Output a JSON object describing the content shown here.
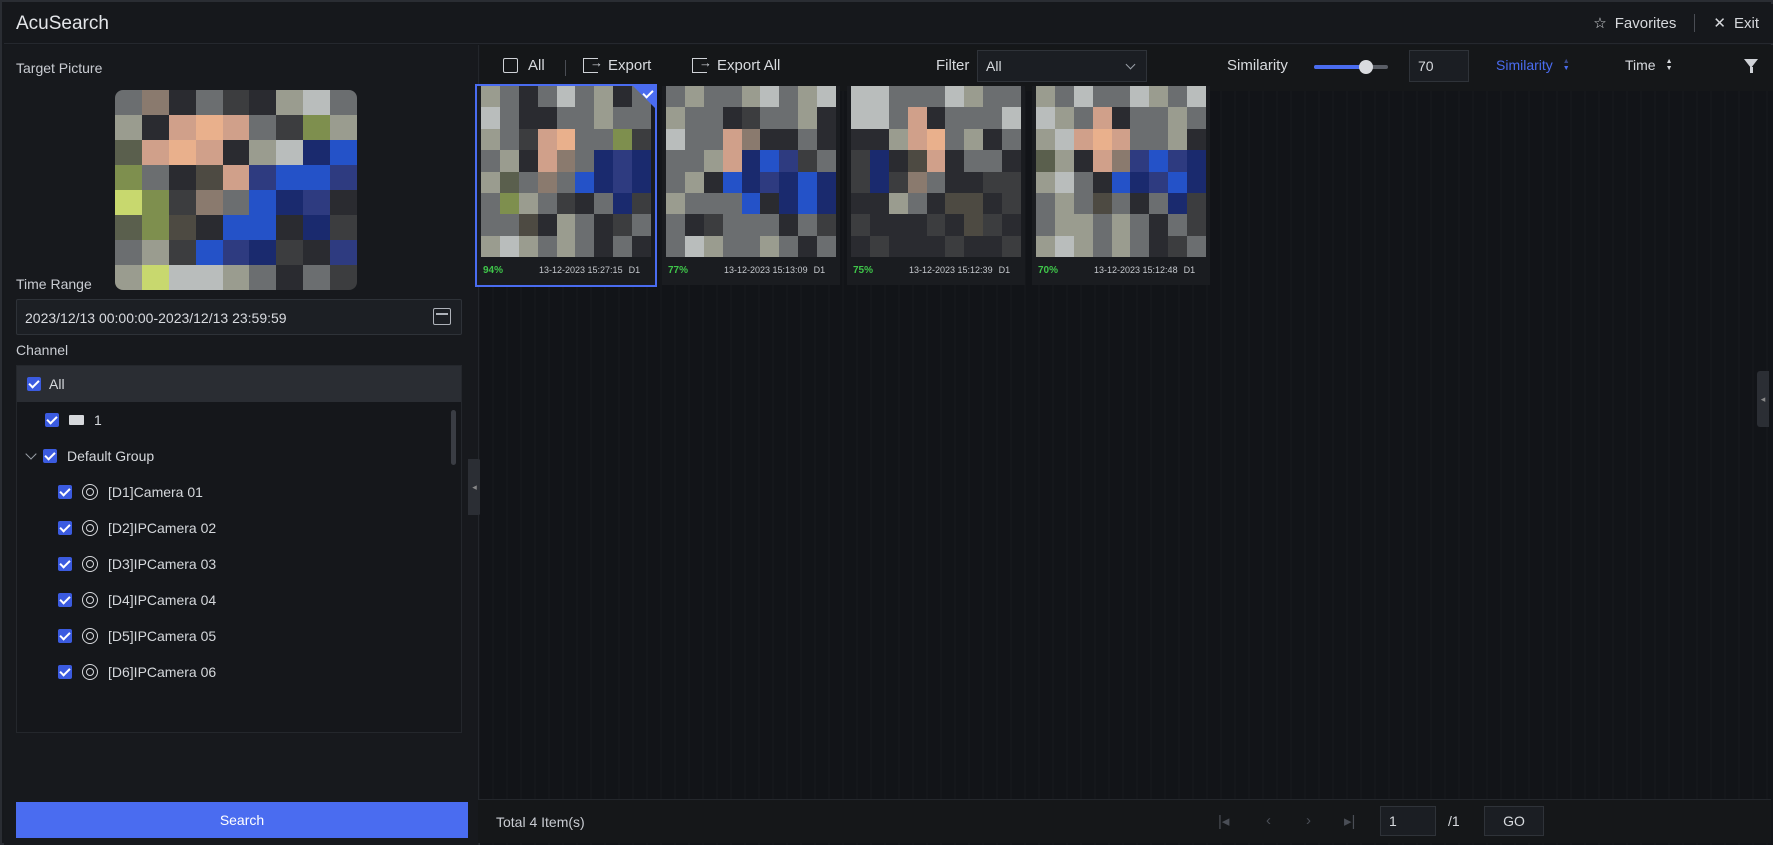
{
  "app": {
    "title": "AcuSearch"
  },
  "titlebar": {
    "favorites_label": "Favorites",
    "exit_label": "Exit",
    "favorites_icon": "star-icon",
    "exit_icon": "close-icon"
  },
  "left": {
    "target_picture_label": "Target Picture",
    "time_range_label": "Time Range",
    "time_range_value": "2023/12/13 00:00:00-2023/12/13 23:59:59",
    "channel_label": "Channel",
    "tree": {
      "all": "All",
      "node1": "1",
      "group": "Default Group",
      "cameras": [
        "[D1]Camera 01",
        "[D2]IPCamera 02",
        "[D3]IPCamera 03",
        "[D4]IPCamera 04",
        "[D5]IPCamera 05",
        "[D6]IPCamera 06"
      ]
    },
    "search_label": "Search"
  },
  "toolbar": {
    "all_label": "All",
    "export_label": "Export",
    "export_all_label": "Export All",
    "filter_label": "Filter",
    "filter_value": "All",
    "similarity_label": "Similarity",
    "similarity_value": "70",
    "similarity_percent": 70,
    "sort_similarity": "Similarity",
    "sort_time": "Time"
  },
  "results": [
    {
      "similarity": "94%",
      "timestamp": "13-12-2023 15:27:15",
      "channel": "D1",
      "selected": true
    },
    {
      "similarity": "77%",
      "timestamp": "13-12-2023 15:13:09",
      "channel": "D1",
      "selected": false
    },
    {
      "similarity": "75%",
      "timestamp": "13-12-2023 15:12:39",
      "channel": "D1",
      "selected": false
    },
    {
      "similarity": "70%",
      "timestamp": "13-12-2023 15:12:48",
      "channel": "D1",
      "selected": false
    }
  ],
  "footer": {
    "total": "Total 4 Item(s)",
    "page": "1",
    "page_total": "/1",
    "go_label": "GO"
  },
  "colors": {
    "accent": "#4a6cf0",
    "match_green": "#3fc64a",
    "background": "#16181c"
  }
}
